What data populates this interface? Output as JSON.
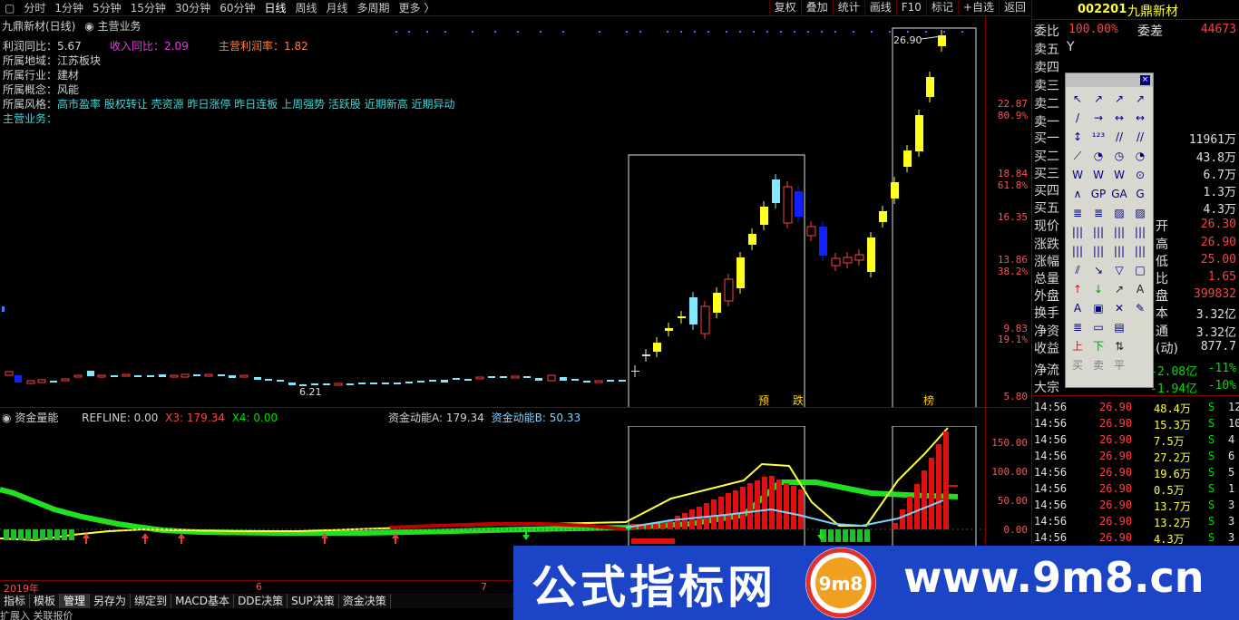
{
  "topbar": {
    "nav": [
      "分时",
      "1分钟",
      "5分钟",
      "15分钟",
      "30分钟",
      "60分钟",
      "日线",
      "周线",
      "月线",
      "多周期",
      "更多 〉"
    ],
    "active": "日线",
    "tools": [
      "复权",
      "叠加",
      "统计",
      "画线",
      "F10",
      "标记",
      "+自选",
      "返回"
    ]
  },
  "main_title": "九鼎新材(日线)",
  "main_indicator": "主营业务",
  "info": {
    "row1": [
      {
        "k": "利润同比：5.67",
        "cls": "c1"
      },
      {
        "k": "收入同比：2.09",
        "cls": "pink"
      },
      {
        "k": "主营利润率：1.82",
        "cls": "orange"
      }
    ],
    "region_label": "所属地域：",
    "region": "江苏板块",
    "industry_label": "所属行业：",
    "industry": "建材",
    "concept_label": "所属概念：",
    "concept": "风能",
    "style_label": "所属风格：",
    "style": "高市盈率 股权转让 壳资源 昨日涨停 昨日连板 上周强势 活跃股 近期新高 近期异动",
    "business_label": "主营业务："
  },
  "price_axis": [
    "22.87",
    "80.9%",
    "18.84",
    "61.8%",
    "16.35",
    "13.86",
    "38.2%",
    "9.83",
    "19.1%",
    "5.80"
  ],
  "annotations": {
    "high": "26.90",
    "low": "6.21",
    "mark1": "预",
    "mark2": "跌",
    "mark3": "榜"
  },
  "sub": {
    "title": "资金量能",
    "refline": "REFLINE: 0.00",
    "x3": "X3: 179.34",
    "x4": "X4: 0.00",
    "a": "资金动能A: 179.34",
    "b": "资金动能B: 50.33",
    "axis": [
      "150.00",
      "100.00",
      "50.00",
      "0.00"
    ]
  },
  "xaxis": [
    "2019年",
    "6",
    "7"
  ],
  "bottom_tabs": [
    "指标",
    "模板",
    "管理",
    "另存为",
    "绑定到",
    "MACD基本",
    "DDE决策",
    "SUP决策",
    "资金决策"
  ],
  "bottom_active": "管理",
  "status": "扩展入   关联报价",
  "right": {
    "code": "002201",
    "name": "九鼎新材",
    "weibi_label": "委比",
    "weibi": "100.00%",
    "weicha_label": "委差",
    "weicha": "44673",
    "sell": [
      "卖五",
      "卖四",
      "卖三",
      "卖二",
      "卖一"
    ],
    "sell5_extra": "Y",
    "buy": [
      {
        "l": "买一",
        "v": "11961万"
      },
      {
        "l": "买二",
        "v": "43.8万"
      },
      {
        "l": "买三",
        "v": "6.7万"
      },
      {
        "l": "买四",
        "v": "1.3万"
      },
      {
        "l": "买五",
        "v": "4.3万"
      }
    ],
    "stats": [
      {
        "l": "现价",
        "r": "开",
        "v": "26.30",
        "c": "red"
      },
      {
        "l": "涨跌",
        "r": "高",
        "v": "26.90",
        "c": "red"
      },
      {
        "l": "涨幅",
        "r": "低",
        "v": "25.00",
        "c": "red"
      },
      {
        "l": "总量",
        "r": "比",
        "v": "1.65",
        "c": "red"
      },
      {
        "l": "外盘",
        "r": "盘",
        "v": "399832",
        "c": "red"
      },
      {
        "l": "换手",
        "r": "本",
        "v": "3.32亿",
        "c": "wht"
      },
      {
        "l": "净资",
        "r": "通",
        "v": "3.32亿",
        "c": "wht"
      },
      {
        "l": "收益",
        "r": "(动)",
        "v": "877.7",
        "c": "wht"
      }
    ],
    "flow": [
      {
        "l": "净流",
        "v": "-2.08亿",
        "p": "-11%"
      },
      {
        "l": "大宗",
        "v": "-1.94亿",
        "p": "-10%"
      }
    ],
    "ticks": [
      {
        "t": "14:56",
        "p": "26.90",
        "v": "48.4万",
        "s": "S",
        "n": "12"
      },
      {
        "t": "14:56",
        "p": "26.90",
        "v": "15.3万",
        "s": "S",
        "n": "10"
      },
      {
        "t": "14:56",
        "p": "26.90",
        "v": "7.5万",
        "s": "S",
        "n": "4"
      },
      {
        "t": "14:56",
        "p": "26.90",
        "v": "27.2万",
        "s": "S",
        "n": "6"
      },
      {
        "t": "14:56",
        "p": "26.90",
        "v": "19.6万",
        "s": "S",
        "n": "5"
      },
      {
        "t": "14:56",
        "p": "26.90",
        "v": "0.5万",
        "s": "S",
        "n": "1"
      },
      {
        "t": "14:56",
        "p": "26.90",
        "v": "13.7万",
        "s": "S",
        "n": "3"
      },
      {
        "t": "14:56",
        "p": "26.90",
        "v": "13.2万",
        "s": "S",
        "n": "3"
      },
      {
        "t": "14:56",
        "p": "26.90",
        "v": "4.3万",
        "s": "S",
        "n": "3"
      }
    ]
  },
  "toolbox": {
    "close": "×",
    "glyphs": [
      "↖",
      "↗",
      "↗",
      "↗",
      "/",
      "→",
      "↔",
      "↔",
      "↕",
      "¹²³",
      "//",
      "//",
      "⟋",
      "◔",
      "◷",
      "◔",
      "W",
      "W",
      "W",
      "⊙",
      "∧",
      "GP",
      "GA",
      "G",
      "≣",
      "≣",
      "▨",
      "▨",
      "|||",
      "|||",
      "|||",
      "|||",
      "|||",
      "|||",
      "|||",
      "|||",
      "⫽",
      "↘",
      "▽",
      "□",
      "↑",
      "↓",
      "↗",
      "A",
      "A",
      "▣",
      "✕",
      "✎",
      "≣",
      "▭",
      "▤",
      "",
      "上",
      "下",
      "⇅",
      "",
      "买",
      "卖",
      "平",
      ""
    ]
  },
  "watermark": {
    "cn": "公式指标网",
    "url": "www.9m8.cn",
    "logo": "9m8"
  },
  "colors": {
    "up": "#ff4040",
    "down": "#00c0c0",
    "limit": "#ffff00",
    "panel_border": "#800000"
  }
}
